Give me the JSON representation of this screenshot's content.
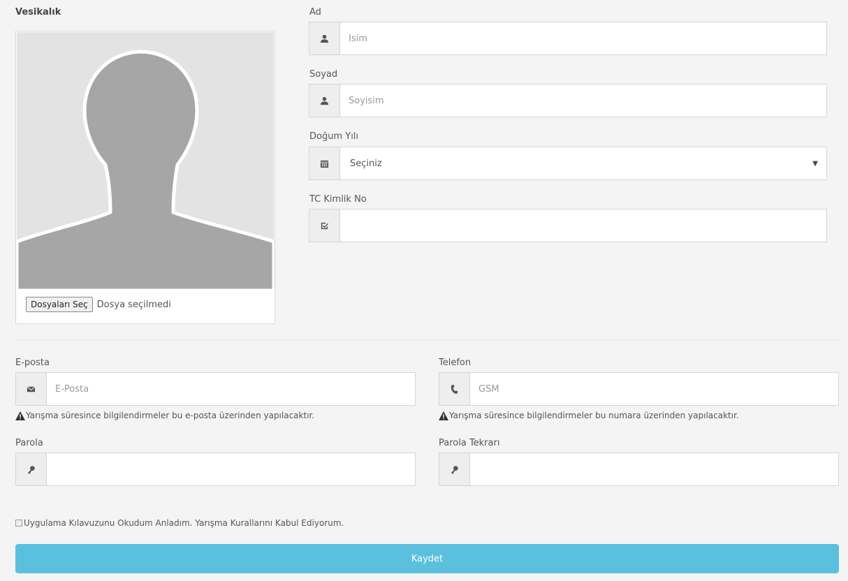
{
  "photo": {
    "title": "Vesikalık",
    "file_button": "Dosyaları Seç",
    "file_status": "Dosya seçilmedi"
  },
  "personal": {
    "first_name": {
      "label": "Ad",
      "placeholder": "İsim",
      "icon": "user-icon"
    },
    "last_name": {
      "label": "Soyad",
      "placeholder": "Soyisim",
      "icon": "user-icon"
    },
    "birth_year": {
      "label": "Doğum Yılı",
      "selected": "Seçiniz",
      "icon": "calendar-icon"
    },
    "tc_no": {
      "label": "TC Kimlik No",
      "placeholder": "",
      "icon": "check-square-icon"
    }
  },
  "contact": {
    "email": {
      "label": "E-posta",
      "placeholder": "E-Posta",
      "icon": "envelope-icon",
      "help": "Yarışma süresince bilgilendirmeler bu e-posta üzerinden yapılacaktır."
    },
    "phone": {
      "label": "Telefon",
      "placeholder": "GSM",
      "icon": "phone-icon",
      "help": "Yarışma süresince bilgilendirmeler bu numara üzerinden yapılacaktır."
    },
    "password": {
      "label": "Parola",
      "icon": "key-icon"
    },
    "password_repeat": {
      "label": "Parola Tekrarı",
      "icon": "key-icon"
    }
  },
  "terms_label": "Uygulama Kılavuzunu Okudum Anladım. Yarışma Kurallarını Kabul Ediyorum.",
  "submit_label": "Kaydet",
  "colors": {
    "submit_bg": "#5bc0de",
    "page_bg": "#f4f4f4",
    "addon_bg": "#eeeeee"
  }
}
